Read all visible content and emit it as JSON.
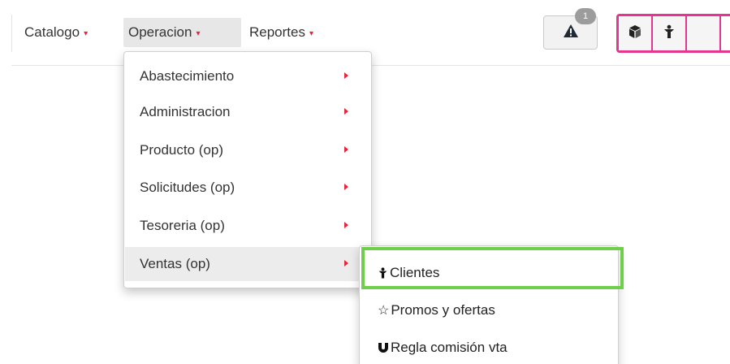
{
  "navbar": {
    "menus": [
      {
        "label": "Catalogo",
        "caret": "▾"
      },
      {
        "label": "Operacion",
        "caret": "▾"
      },
      {
        "label": "Reportes",
        "caret": "▾"
      }
    ],
    "alert": {
      "icon": "warning-icon",
      "badge": "1"
    },
    "toolbar_icons": [
      "box-icon",
      "person-icon"
    ]
  },
  "dropdown": {
    "items": [
      {
        "label": "Abastecimiento"
      },
      {
        "label": "Administracion"
      },
      {
        "label": "Producto (op)"
      },
      {
        "label": "Solicitudes (op)"
      },
      {
        "label": "Tesoreria (op)"
      },
      {
        "label": "Ventas (op)",
        "active": true
      }
    ]
  },
  "submenu": {
    "items": [
      {
        "label": "Clientes",
        "icon": "person-icon"
      },
      {
        "label": "Promos y ofertas",
        "icon": "star-outline-icon",
        "glyph": "☆"
      },
      {
        "label": "Regla comisión vta",
        "icon": "magnet-icon"
      }
    ]
  },
  "colors": {
    "caret": "#e8243c",
    "highlight_green": "#6fcf4a",
    "group_border": "#e5358f"
  }
}
